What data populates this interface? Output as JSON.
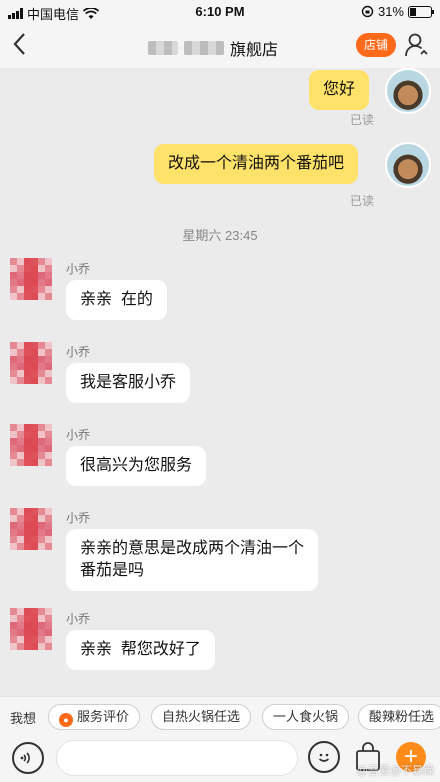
{
  "status_bar": {
    "carrier": "中国电信",
    "time": "6:10 PM",
    "battery": "31%",
    "battery_level": 0.31
  },
  "header": {
    "title": "旗舰店",
    "shop_label": "店铺"
  },
  "messages": [
    {
      "from": "self",
      "text": "您好",
      "read": "已读"
    },
    {
      "from": "self",
      "text": "改成一个清油两个番茄吧",
      "read": "已读"
    },
    {
      "type": "time",
      "text": "星期六 23:45"
    },
    {
      "from": "agent",
      "sender": "小乔",
      "text": "亲亲  在的"
    },
    {
      "from": "agent",
      "sender": "小乔",
      "text": "我是客服小乔"
    },
    {
      "from": "agent",
      "sender": "小乔",
      "text": "很高兴为您服务"
    },
    {
      "from": "agent",
      "sender": "小乔",
      "text": "亲亲的意思是改成两个清油一个\n番茄是吗"
    },
    {
      "from": "agent",
      "sender": "小乔",
      "text": "亲亲  帮您改好了"
    }
  ],
  "quick_bar": {
    "label": "我想",
    "chips": [
      "服务评价",
      "自热火锅任选",
      "一人食火锅",
      "酸辣粉任选"
    ]
  },
  "watermark": "@吾爱@不暴躁"
}
